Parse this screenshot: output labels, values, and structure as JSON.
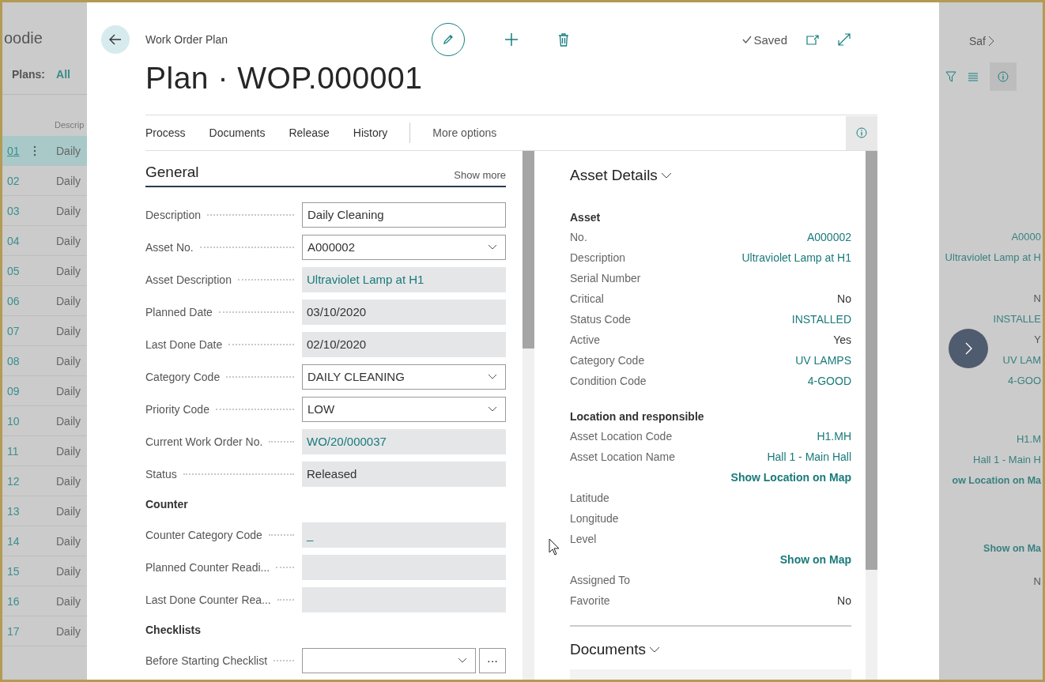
{
  "background_left": {
    "app_title": "oodie",
    "filter_label": "Plans:",
    "filter_value": "All",
    "column_header": "Descrip",
    "rows": [
      {
        "no": "01",
        "description": "Daily",
        "selected": true
      },
      {
        "no": "02",
        "description": "Daily",
        "selected": false
      },
      {
        "no": "03",
        "description": "Daily",
        "selected": false
      },
      {
        "no": "04",
        "description": "Daily",
        "selected": false
      },
      {
        "no": "05",
        "description": "Daily",
        "selected": false
      },
      {
        "no": "06",
        "description": "Daily",
        "selected": false
      },
      {
        "no": "07",
        "description": "Daily",
        "selected": false
      },
      {
        "no": "08",
        "description": "Daily",
        "selected": false
      },
      {
        "no": "09",
        "description": "Daily",
        "selected": false
      },
      {
        "no": "10",
        "description": "Daily",
        "selected": false
      },
      {
        "no": "11",
        "description": "Daily",
        "selected": false
      },
      {
        "no": "12",
        "description": "Daily",
        "selected": false
      },
      {
        "no": "13",
        "description": "Daily",
        "selected": false
      },
      {
        "no": "14",
        "description": "Daily",
        "selected": false
      },
      {
        "no": "15",
        "description": "Daily",
        "selected": false
      },
      {
        "no": "16",
        "description": "Daily",
        "selected": false
      },
      {
        "no": "17",
        "description": "Daily",
        "selected": false
      }
    ]
  },
  "background_right": {
    "breadcrumb": "Saf",
    "groups": [
      {
        "lines": [
          {
            "text": "A0000",
            "kind": "value"
          },
          {
            "text": "Ultraviolet Lamp at H",
            "kind": "value"
          }
        ]
      },
      {
        "lines": [
          {
            "text": "N",
            "kind": "plain"
          },
          {
            "text": "INSTALLE",
            "kind": "value"
          },
          {
            "text": "Y",
            "kind": "plain"
          },
          {
            "text": "UV LAM",
            "kind": "value"
          },
          {
            "text": "4-GOO",
            "kind": "value"
          }
        ]
      },
      {
        "lines": [
          {
            "text": "H1.M",
            "kind": "value"
          },
          {
            "text": "Hall 1 - Main H",
            "kind": "value"
          },
          {
            "text": "ow Location on Ma",
            "kind": "action"
          }
        ]
      },
      {
        "lines": [
          {
            "text": "Show on Ma",
            "kind": "action"
          }
        ]
      },
      {
        "lines": [
          {
            "text": "N",
            "kind": "plain"
          }
        ]
      }
    ]
  },
  "header": {
    "caption": "Work Order Plan",
    "title": "Plan · WOP.000001",
    "status": "Saved"
  },
  "actions": [
    {
      "label": "Process"
    },
    {
      "label": "Documents"
    },
    {
      "label": "Release"
    },
    {
      "label": "History"
    }
  ],
  "more_options": "More options",
  "general": {
    "title": "General",
    "show_more": "Show more",
    "groups": [
      {
        "fields": [
          {
            "label": "Description",
            "value": "Daily Cleaning",
            "kind": "input",
            "link": false
          },
          {
            "label": "Asset No.",
            "value": "A000002",
            "kind": "dropdown",
            "link": false
          },
          {
            "label": "Asset Description",
            "value": "Ultraviolet Lamp at H1",
            "kind": "readonly",
            "link": true
          },
          {
            "label": "Planned Date",
            "value": "03/10/2020",
            "kind": "readonly",
            "link": false
          },
          {
            "label": "Last Done Date",
            "value": "02/10/2020",
            "kind": "readonly",
            "link": false
          },
          {
            "label": "Category Code",
            "value": "DAILY CLEANING",
            "kind": "dropdown",
            "link": false
          },
          {
            "label": "Priority Code",
            "value": "LOW",
            "kind": "dropdown",
            "link": false
          },
          {
            "label": "Current Work Order No.",
            "value": "WO/20/000037",
            "kind": "readonly",
            "link": true
          },
          {
            "label": "Status",
            "value": "Released",
            "kind": "readonly",
            "link": false
          }
        ]
      },
      {
        "heading": "Counter",
        "fields": [
          {
            "label": "Counter Category Code",
            "value": "_",
            "kind": "readonly",
            "link": true
          },
          {
            "label": "Planned Counter Readi...",
            "kind": "readonly"
          },
          {
            "label": "Last Done Counter Rea...",
            "kind": "readonly"
          }
        ]
      },
      {
        "heading": "Checklists",
        "fields": [
          {
            "label": "Before Starting Checklist",
            "kind": "dropdown_assist",
            "assist": "···"
          }
        ]
      }
    ]
  },
  "asset_details": {
    "title": "Asset Details",
    "groups": [
      {
        "heading": "Asset",
        "rows": [
          {
            "kind": "field",
            "label": "No.",
            "value": "A000002",
            "link": true
          },
          {
            "kind": "field",
            "label": "Description",
            "value": "Ultraviolet Lamp at H1",
            "link": true
          },
          {
            "kind": "field",
            "label": "Serial Number"
          },
          {
            "kind": "field",
            "label": "Critical",
            "value": "No",
            "link": false
          },
          {
            "kind": "field",
            "label": "Status Code",
            "value": "INSTALLED",
            "link": true
          },
          {
            "kind": "field",
            "label": "Active",
            "value": "Yes",
            "link": false
          },
          {
            "kind": "field",
            "label": "Category Code",
            "value": "UV LAMPS",
            "link": true
          },
          {
            "kind": "field",
            "label": "Condition Code",
            "value": "4-GOOD",
            "link": true
          }
        ]
      },
      {
        "heading": "Location and responsible",
        "rows": [
          {
            "kind": "field",
            "label": "Asset Location Code",
            "value": "H1.MH",
            "link": true
          },
          {
            "kind": "field",
            "label": "Asset Location Name",
            "value": "Hall 1 - Main Hall",
            "link": true
          },
          {
            "kind": "action",
            "value": "Show Location on Map"
          },
          {
            "kind": "field",
            "label": "Latitude"
          },
          {
            "kind": "field",
            "label": "Longitude"
          },
          {
            "kind": "field",
            "label": "Level"
          },
          {
            "kind": "action",
            "value": "Show on Map"
          },
          {
            "kind": "field",
            "label": "Assigned To"
          },
          {
            "kind": "field",
            "label": "Favorite",
            "value": "No",
            "link": false
          }
        ]
      }
    ]
  },
  "documents": {
    "title": "Documents"
  }
}
